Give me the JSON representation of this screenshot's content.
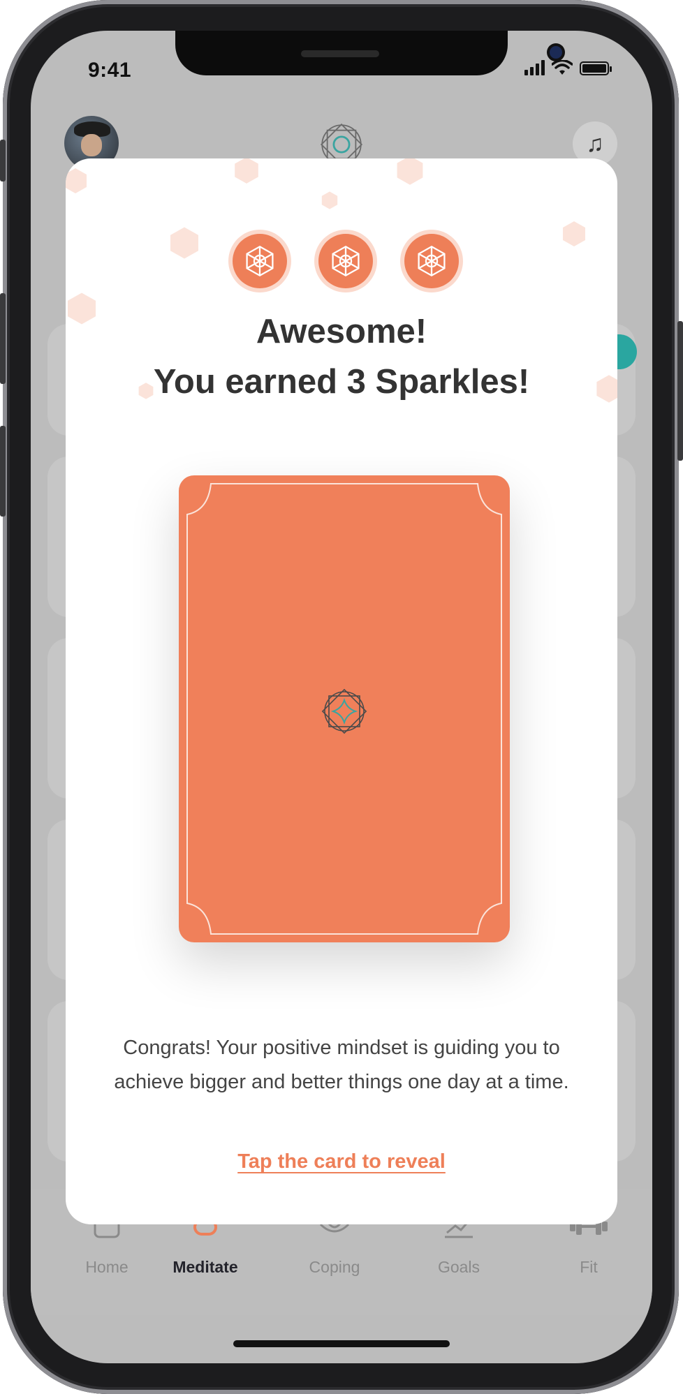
{
  "status_bar": {
    "time": "9:41"
  },
  "header": {
    "avatar_icon": "profile-avatar",
    "logo_icon": "mandala-logo-icon",
    "music_icon": "music-note-icon"
  },
  "modal": {
    "sparkle_icons": [
      "sparkle-icon",
      "sparkle-icon",
      "sparkle-icon"
    ],
    "title_line1": "Awesome!",
    "title_line2": "You earned 3 Sparkles!",
    "message": "Congrats! Your positive mindset is guiding you to achieve bigger and better things one day at a time.",
    "reveal_label": "Tap the card to reveal",
    "accent_color": "#EE7F58",
    "card_color": "#F0805A"
  },
  "tabbar": {
    "tabs": [
      {
        "label": "Home",
        "icon": "home-icon",
        "active": false
      },
      {
        "label": "Meditate",
        "icon": "meditate-icon",
        "active": true
      },
      {
        "label": "Coping",
        "icon": "lotus-icon",
        "active": false
      },
      {
        "label": "Goals",
        "icon": "chart-icon",
        "active": false
      },
      {
        "label": "Fit",
        "icon": "dumbbell-icon",
        "active": false
      }
    ]
  }
}
